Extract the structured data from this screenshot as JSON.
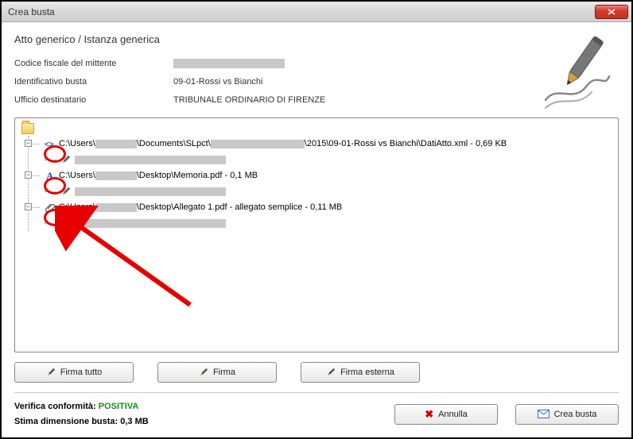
{
  "window": {
    "title": "Crea busta"
  },
  "header": {
    "breadcrumb": "Atto generico / Istanza generica",
    "rows": [
      {
        "label": "Codice fiscale del mittente",
        "value": ""
      },
      {
        "label": "Identificativo busta",
        "value": "09-01-Rossi vs Bianchi"
      },
      {
        "label": "Ufficio destinatario",
        "value": "TRIBUNALE ORDINARIO DI FIRENZE"
      }
    ]
  },
  "tree": {
    "items": [
      {
        "prefix": "C:\\Users\\",
        "mid1": "\\Documents\\SLpct\\",
        "suffix": "\\2015\\09-01-Rossi vs Bianchi\\DatiAtto.xml - 0,69 KB",
        "icon": "xml"
      },
      {
        "prefix": "C:\\Users\\",
        "suffix": "\\Desktop\\Memoria.pdf - 0,1 MB",
        "icon": "A"
      },
      {
        "prefix": "C:\\Users\\",
        "suffix": "\\Desktop\\Allegato 1.pdf - allegato semplice - 0,11 MB",
        "icon": "clip"
      }
    ]
  },
  "buttons": {
    "sign_all": "Firma tutto",
    "sign": "Firma",
    "sign_external": "Firma esterna",
    "cancel": "Annulla",
    "create": "Crea busta"
  },
  "footer": {
    "conformity_label": "Verifica conformità: ",
    "conformity_value": "POSITIVA",
    "conformity_color": "#1a8b1a",
    "size_label": "Stima dimensione busta: ",
    "size_value": "0,3 MB"
  }
}
